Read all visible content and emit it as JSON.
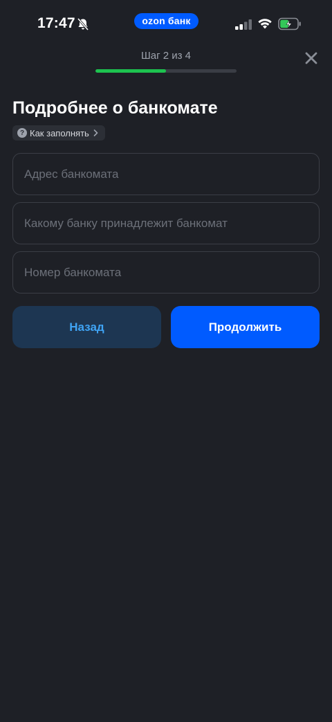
{
  "status_bar": {
    "time": "17:47",
    "brand": "ozon банк",
    "icons": [
      "bell-off-icon",
      "cellular-signal-icon",
      "wifi-icon",
      "battery-charging-icon"
    ]
  },
  "header": {
    "step_label": "Шаг 2 из 4",
    "progress": 0.5,
    "close_icon": "close-icon"
  },
  "main": {
    "title": "Подробнее о банкомате",
    "help_link": "Как заполнять",
    "fields": [
      {
        "placeholder": "Адрес банкомата",
        "value": ""
      },
      {
        "placeholder": "Какому банку принадлежит банкомат",
        "value": ""
      },
      {
        "placeholder": "Номер банкомата",
        "value": ""
      }
    ],
    "back_label": "Назад",
    "continue_label": "Продолжить"
  },
  "colors": {
    "background": "#1e2026",
    "accent": "#005bff",
    "progress": "#1dc24f",
    "back_button_bg": "#1d3652",
    "back_button_text": "#3fa4f5"
  }
}
